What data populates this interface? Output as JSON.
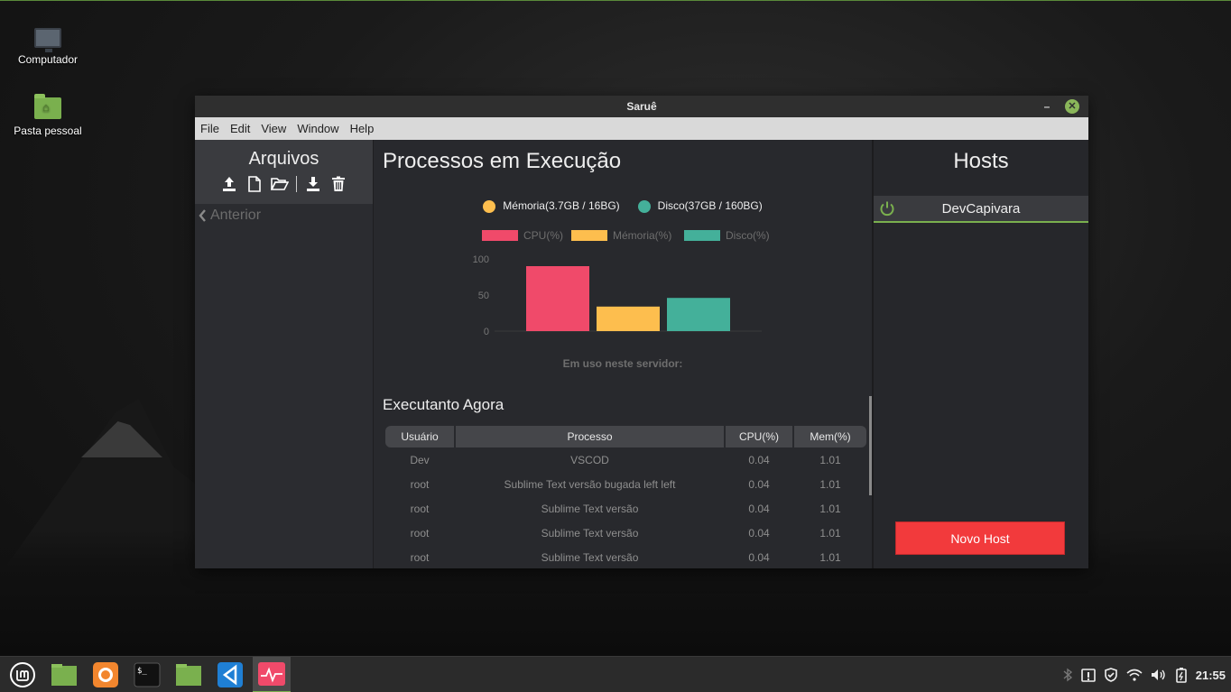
{
  "desktop": {
    "icons": [
      {
        "label": "Computador"
      },
      {
        "label": "Pasta pessoal"
      }
    ]
  },
  "window": {
    "title": "Saruê",
    "minimize_label": "–",
    "close_label": "✕",
    "menu": [
      "File",
      "Edit",
      "View",
      "Window",
      "Help"
    ]
  },
  "files_panel": {
    "title": "Arquivos",
    "back_label": "Anterior",
    "icons": [
      "upload-icon",
      "new-file-icon",
      "open-folder-icon",
      "download-icon",
      "trash-icon"
    ]
  },
  "processes": {
    "title": "Processos em Execução",
    "summary_legend": [
      {
        "label": "Mémoria(3.7GB / 16BG)",
        "color": "#fdbe4e"
      },
      {
        "label": "Disco(37GB / 160BG)",
        "color": "#44b09a"
      }
    ],
    "chart_caption": "Em uso neste servidor:",
    "running_title": "Executanto Agora",
    "table": {
      "headers": [
        "Usuário",
        "Processo",
        "CPU(%)",
        "Mem(%)"
      ],
      "rows": [
        [
          "Dev",
          "VSCOD",
          "0.04",
          "1.01"
        ],
        [
          "root",
          "Sublime Text versão bugada left left",
          "0.04",
          "1.01"
        ],
        [
          "root",
          "Sublime Text versão",
          "0.04",
          "1.01"
        ],
        [
          "root",
          "Sublime Text versão",
          "0.04",
          "1.01"
        ],
        [
          "root",
          "Sublime Text versão",
          "0.04",
          "1.01"
        ]
      ]
    }
  },
  "chart_data": {
    "type": "bar",
    "categories": [
      "CPU(%)",
      "Mémoria(%)",
      "Disco(%)"
    ],
    "series": [
      {
        "name": "CPU(%)",
        "color": "#f04a6a",
        "values": [
          90
        ]
      },
      {
        "name": "Mémoria(%)",
        "color": "#fdbe4e",
        "values": [
          34
        ]
      },
      {
        "name": "Disco(%)",
        "color": "#44b09a",
        "values": [
          46
        ]
      }
    ],
    "yticks": [
      0,
      50,
      100
    ],
    "ylim": [
      0,
      100
    ],
    "legend_position": "top",
    "title": "",
    "xlabel": "",
    "ylabel": ""
  },
  "hosts_panel": {
    "title": "Hosts",
    "hosts": [
      {
        "name": "DevCapivara",
        "status_color": "#7ab04e"
      }
    ],
    "new_host_label": "Novo Host"
  },
  "taskbar": {
    "apps": [
      "mint-menu-icon",
      "files-icon",
      "firefox-icon",
      "terminal-icon",
      "folder-icon",
      "vscode-icon",
      "sarue-icon"
    ],
    "terminal_prompt": "$_",
    "clock": "21:55"
  }
}
